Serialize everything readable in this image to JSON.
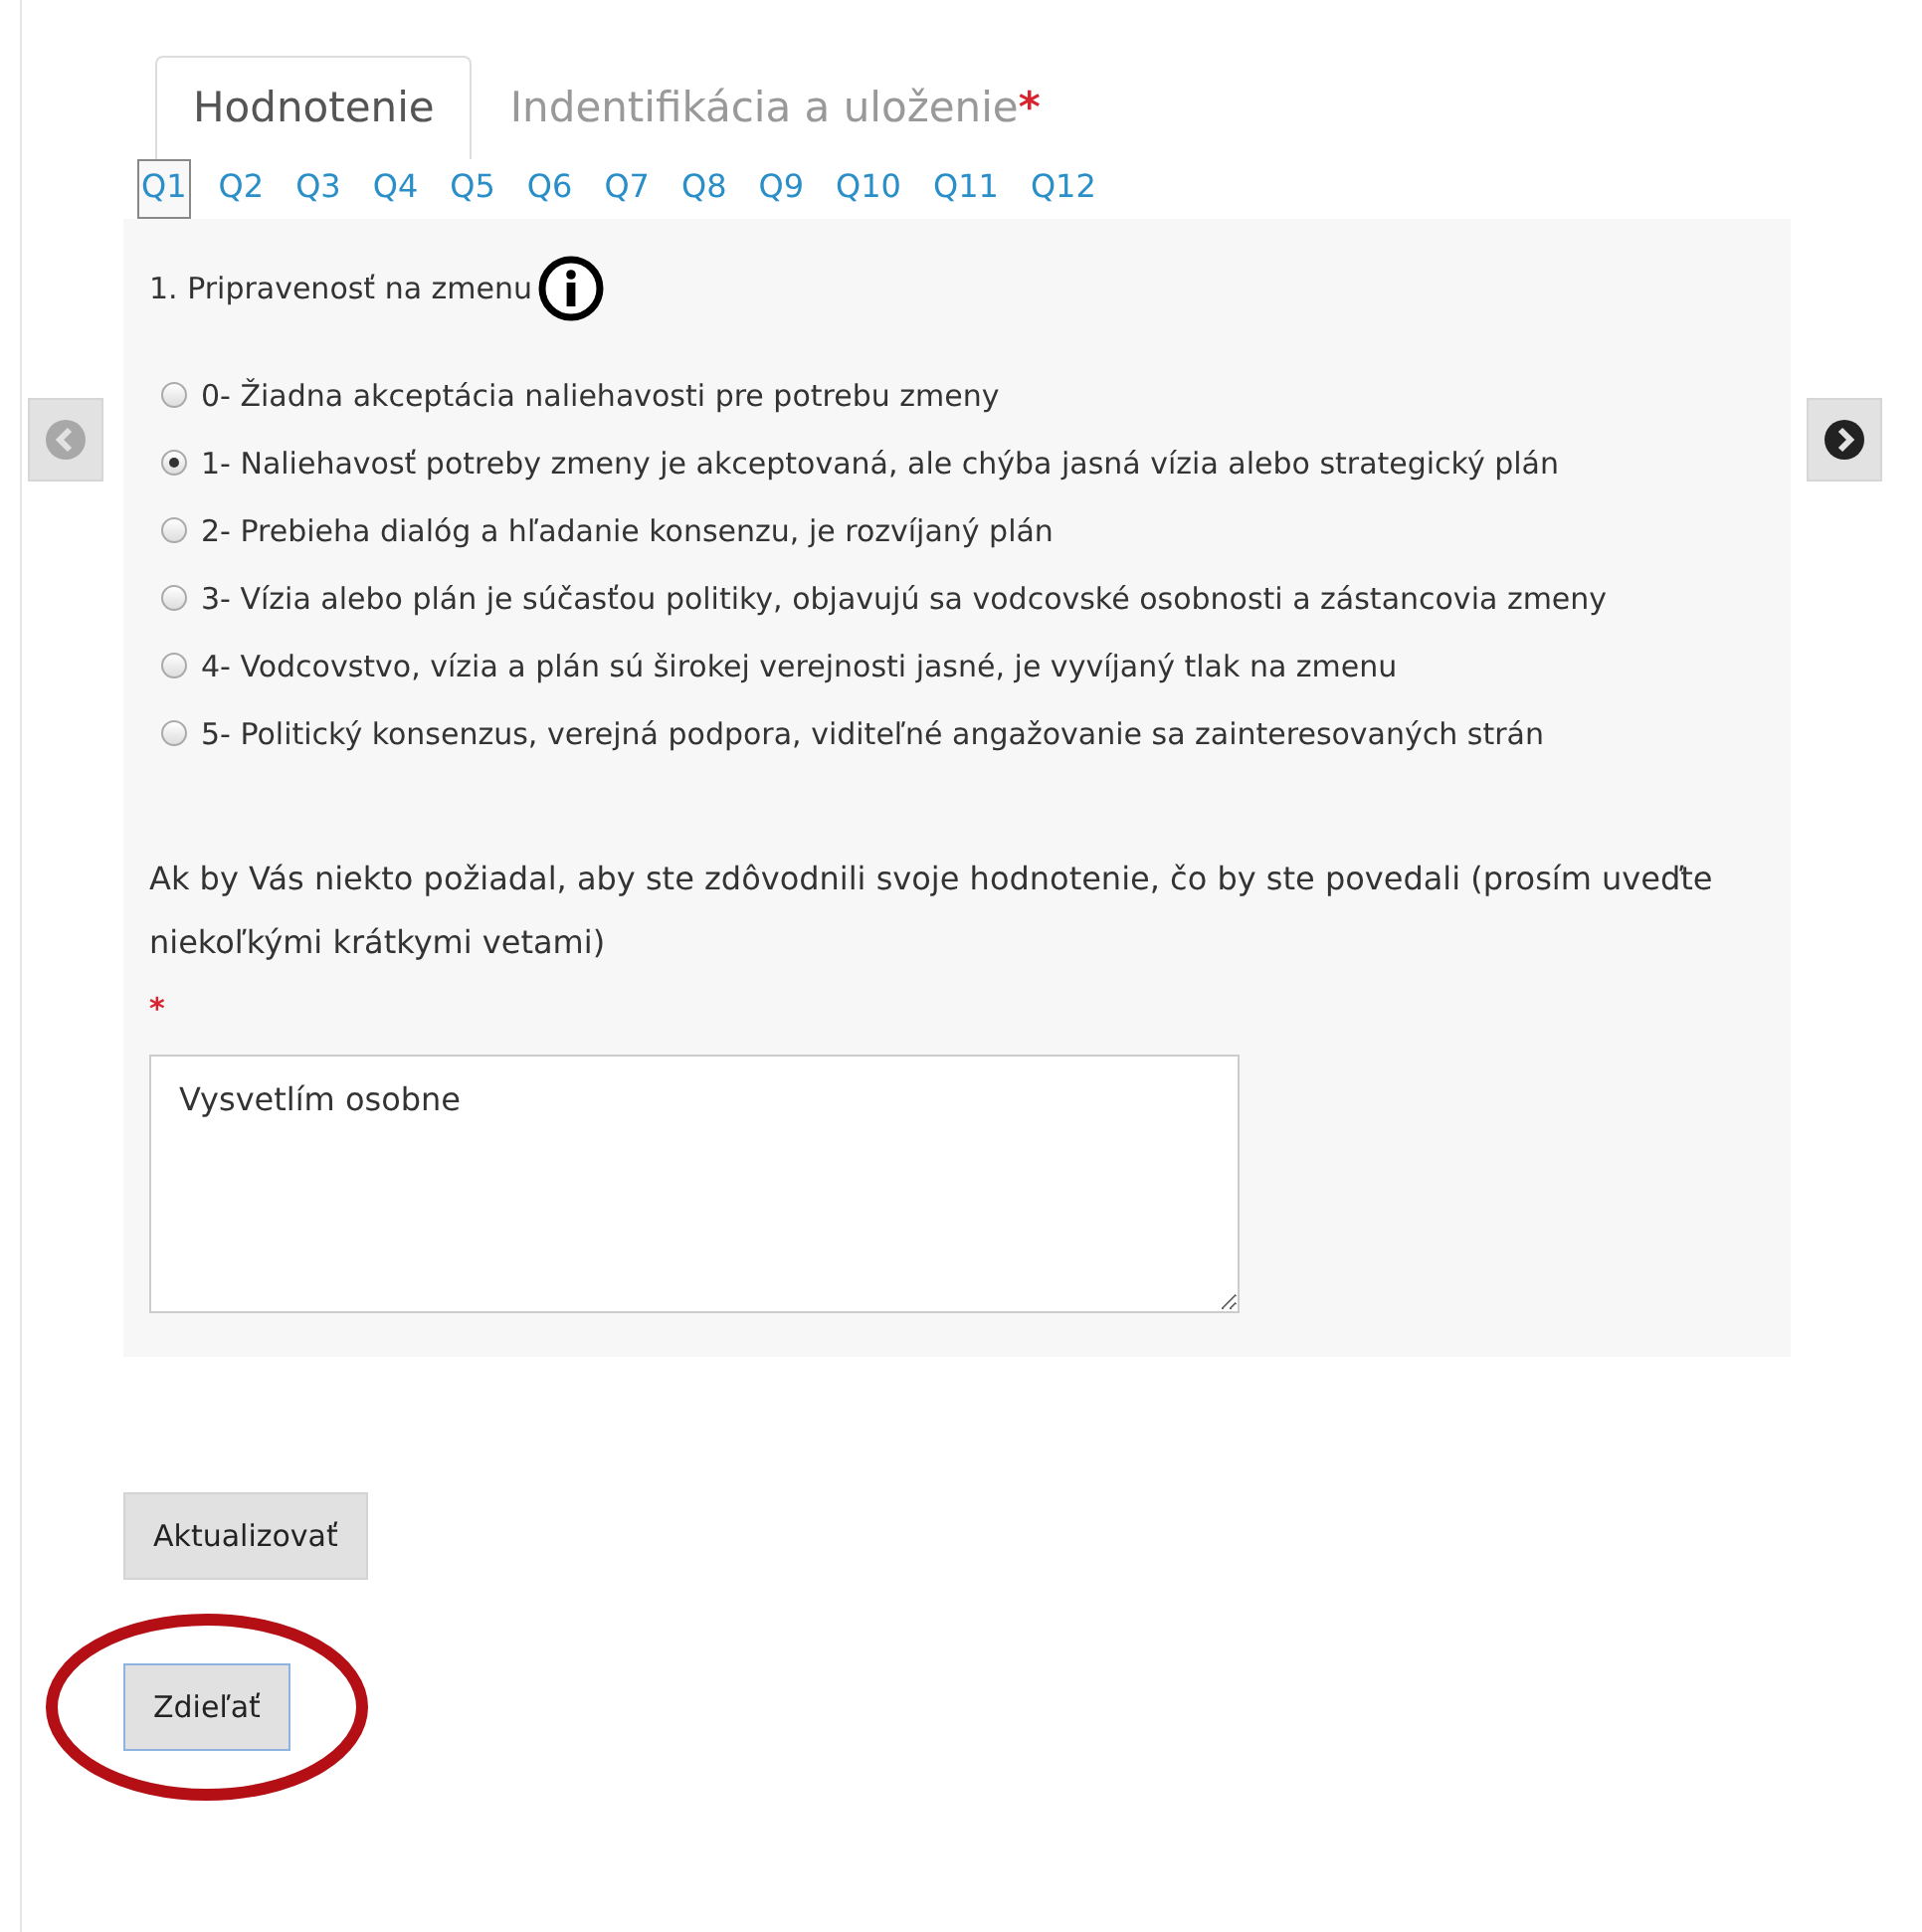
{
  "tabs": [
    {
      "label": "Hodnotenie",
      "selected": true,
      "required": false
    },
    {
      "label": "Indentifikácia a uloženie",
      "selected": false,
      "required": true
    }
  ],
  "question_nav": [
    {
      "label": "Q1",
      "selected": true
    },
    {
      "label": "Q2",
      "selected": false
    },
    {
      "label": "Q3",
      "selected": false
    },
    {
      "label": "Q4",
      "selected": false
    },
    {
      "label": "Q5",
      "selected": false
    },
    {
      "label": "Q6",
      "selected": false
    },
    {
      "label": "Q7",
      "selected": false
    },
    {
      "label": "Q8",
      "selected": false
    },
    {
      "label": "Q9",
      "selected": false
    },
    {
      "label": "Q10",
      "selected": false
    },
    {
      "label": "Q11",
      "selected": false
    },
    {
      "label": "Q12",
      "selected": false
    }
  ],
  "question": {
    "title": "1. Pripravenosť na zmenu",
    "options": [
      {
        "label": "0- Žiadna akceptácia naliehavosti pre potrebu zmeny",
        "selected": false
      },
      {
        "label": "1- Naliehavosť potreby zmeny je akceptovaná, ale chýba jasná vízia alebo strategický plán",
        "selected": true
      },
      {
        "label": "2- Prebieha dialóg a hľadanie konsenzu, je rozvíjaný plán",
        "selected": false
      },
      {
        "label": "3- Vízia alebo plán je súčasťou politiky, objavujú sa vodcovské osobnosti a zástancovia zmeny",
        "selected": false
      },
      {
        "label": "4- Vodcovstvo, vízia a plán sú širokej verejnosti jasné, je vyvíjaný tlak na zmenu",
        "selected": false
      },
      {
        "label": "5- Politický konsenzus, verejná podpora, viditeľné angažovanie sa zainteresovaných strán",
        "selected": false
      }
    ],
    "justification_prompt": "Ak by Vás niekto požiadal, aby ste zdôvodnili svoje hodnotenie, čo by ste povedali (prosím uveďte niekoľkými krátkymi vetami)",
    "required_mark": "*",
    "answer": "Vysvetlím osobne"
  },
  "buttons": [
    {
      "label": "Aktualizovať",
      "highlighted": false
    },
    {
      "label": "Zdieľať",
      "highlighted": true
    }
  ]
}
